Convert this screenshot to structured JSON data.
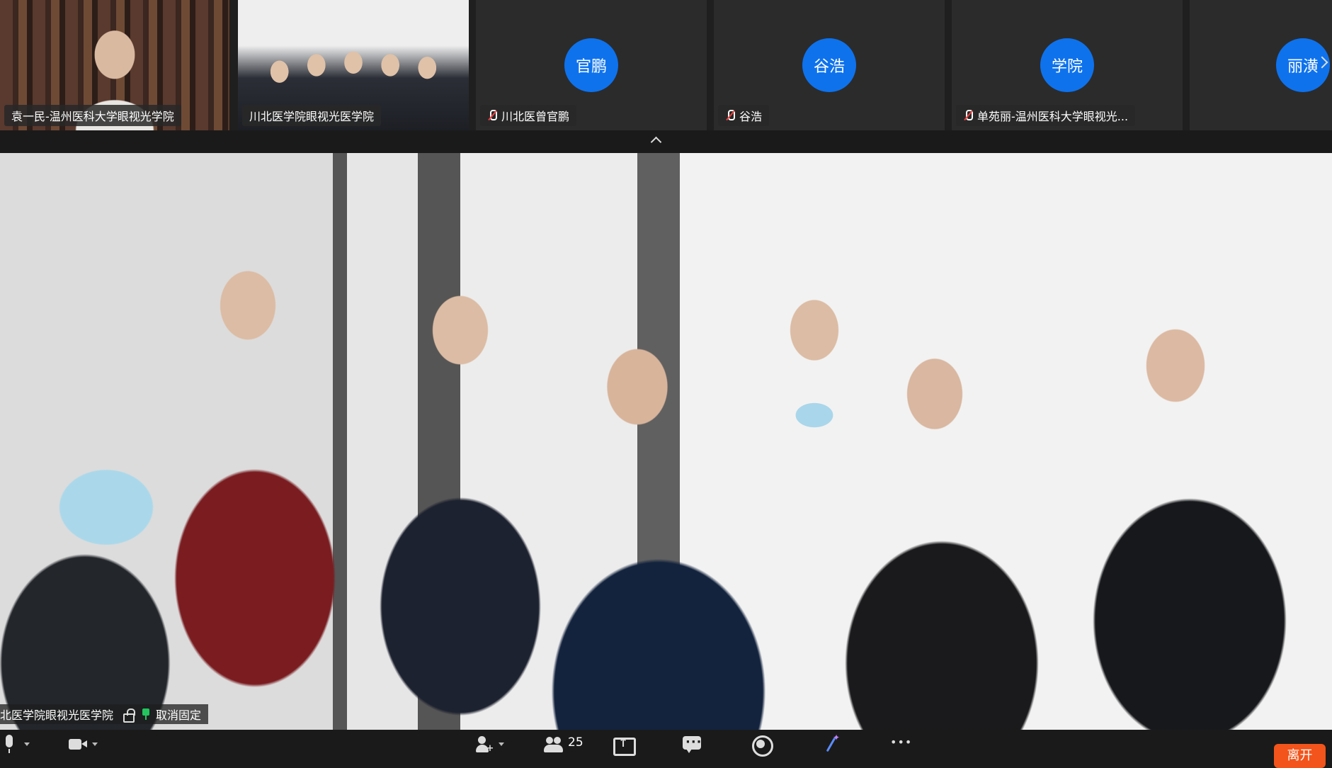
{
  "participants_strip": {
    "tiles": [
      {
        "type": "video",
        "name": "袁一民-温州医科大学眼视光学院",
        "muted": false
      },
      {
        "type": "video",
        "name": "川北医学院眼视光医学院",
        "muted": false,
        "active_speaker": true
      },
      {
        "type": "avatar",
        "avatar_text": "官鹏",
        "name": "川北医曾官鹏",
        "muted": true
      },
      {
        "type": "avatar",
        "avatar_text": "谷浩",
        "name": "谷浩",
        "muted": true
      },
      {
        "type": "avatar",
        "avatar_text": "学院",
        "name": "单苑丽-温州医科大学眼视光...",
        "muted": true
      },
      {
        "type": "avatar",
        "avatar_text": "丽潢",
        "name": "",
        "muted": true
      }
    ],
    "avatar_color": "#0e72ed",
    "active_border_color": "#22c55e"
  },
  "main_video": {
    "pinned_name": "北医学院眼视光医学院",
    "unpin_label": "取消固定"
  },
  "toolbar": {
    "participants_count": "25",
    "leave_label": "离开",
    "leave_color": "#f2541b",
    "icons": [
      "mic-icon",
      "camera-icon",
      "invite-icon",
      "participants-icon",
      "share-screen-icon",
      "chat-icon",
      "record-icon",
      "apps-icon",
      "more-icon"
    ]
  }
}
